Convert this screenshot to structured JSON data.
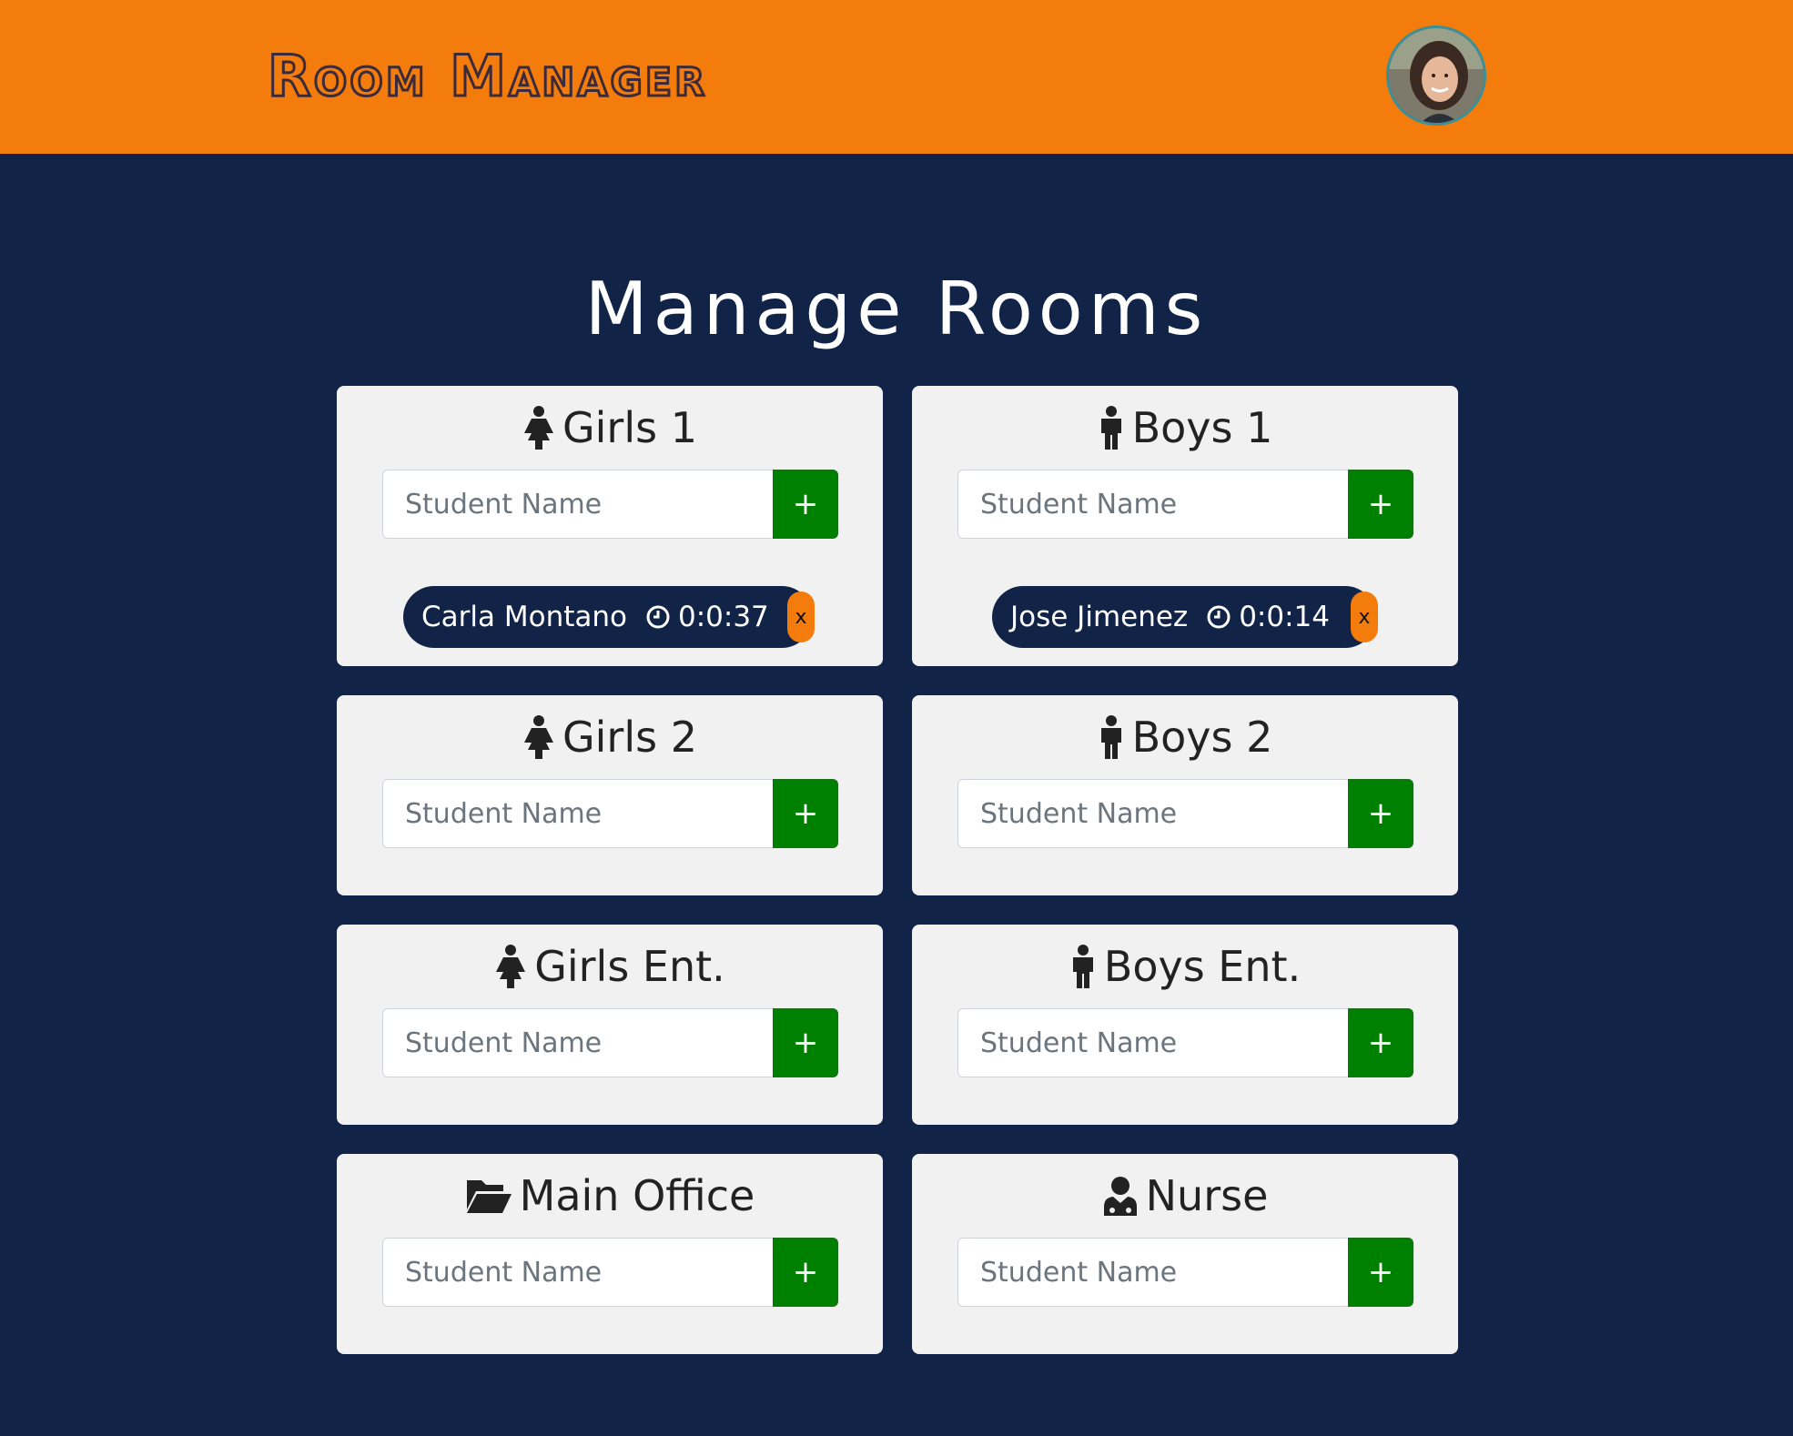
{
  "header": {
    "app_title": "Room Manager",
    "brand_color": "#f47c0d",
    "background_color": "#112447"
  },
  "main": {
    "title": "Manage Rooms",
    "input_placeholder": "Student Name",
    "add_label": "+",
    "rooms": [
      {
        "name": "Girls 1",
        "icon": "female-icon",
        "students": [
          {
            "name": "Carla Montano",
            "time": "0:0:37",
            "remove": "x"
          }
        ]
      },
      {
        "name": "Boys 1",
        "icon": "male-icon",
        "students": [
          {
            "name": "Jose Jimenez",
            "time": "0:0:14",
            "remove": "x"
          }
        ]
      },
      {
        "name": "Girls 2",
        "icon": "female-icon",
        "students": []
      },
      {
        "name": "Boys 2",
        "icon": "male-icon",
        "students": []
      },
      {
        "name": "Girls Ent.",
        "icon": "female-icon",
        "students": []
      },
      {
        "name": "Boys Ent.",
        "icon": "male-icon",
        "students": []
      },
      {
        "name": "Main Office",
        "icon": "folder-open-icon",
        "students": []
      },
      {
        "name": "Nurse",
        "icon": "doctor-icon",
        "students": []
      }
    ]
  }
}
